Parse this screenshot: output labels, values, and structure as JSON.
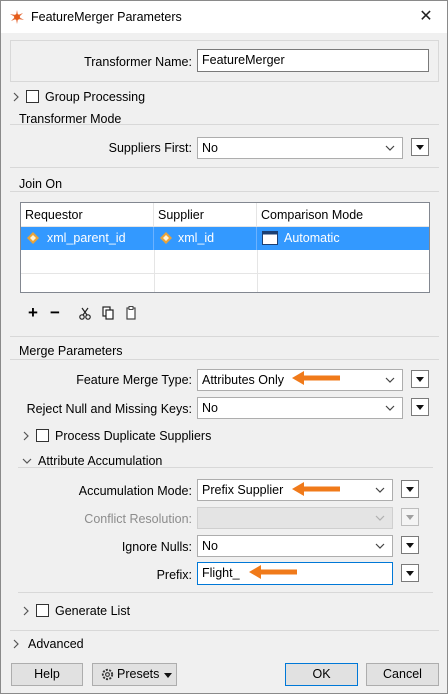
{
  "window": {
    "title": "FeatureMerger Parameters",
    "close_glyph": "✕"
  },
  "transformer_name": {
    "label": "Transformer Name:",
    "value": "FeatureMerger"
  },
  "group_processing": {
    "label": "Group Processing",
    "checked": false
  },
  "transformer_mode": {
    "section": "Transformer Mode",
    "suppliers_first_label": "Suppliers First:",
    "suppliers_first_value": "No"
  },
  "join_on": {
    "section": "Join On",
    "columns": [
      "Requestor",
      "Supplier",
      "Comparison Mode"
    ],
    "rows": [
      {
        "requestor": "xml_parent_id",
        "supplier": "xml_id",
        "mode": "Automatic"
      }
    ],
    "tools": {
      "add": "+",
      "remove": "−"
    }
  },
  "merge_parameters": {
    "section": "Merge Parameters",
    "feature_merge_type_label": "Feature Merge Type:",
    "feature_merge_type_value": "Attributes Only",
    "reject_null_label": "Reject Null and Missing Keys:",
    "reject_null_value": "No",
    "process_duplicate_label": "Process Duplicate Suppliers",
    "attribute_accumulation": {
      "section": "Attribute Accumulation",
      "accumulation_mode_label": "Accumulation Mode:",
      "accumulation_mode_value": "Prefix Supplier",
      "conflict_resolution_label": "Conflict Resolution:",
      "conflict_resolution_value": "",
      "ignore_nulls_label": "Ignore Nulls:",
      "ignore_nulls_value": "No",
      "prefix_label": "Prefix:",
      "prefix_value": "Flight_"
    },
    "generate_list_label": "Generate List"
  },
  "advanced": {
    "label": "Advanced"
  },
  "footer": {
    "help": "Help",
    "presets": "Presets",
    "ok": "OK",
    "cancel": "Cancel"
  },
  "colors": {
    "accent": "#0078d7",
    "selection": "#3399ff",
    "annotation_arrow": "#f07a1a"
  }
}
